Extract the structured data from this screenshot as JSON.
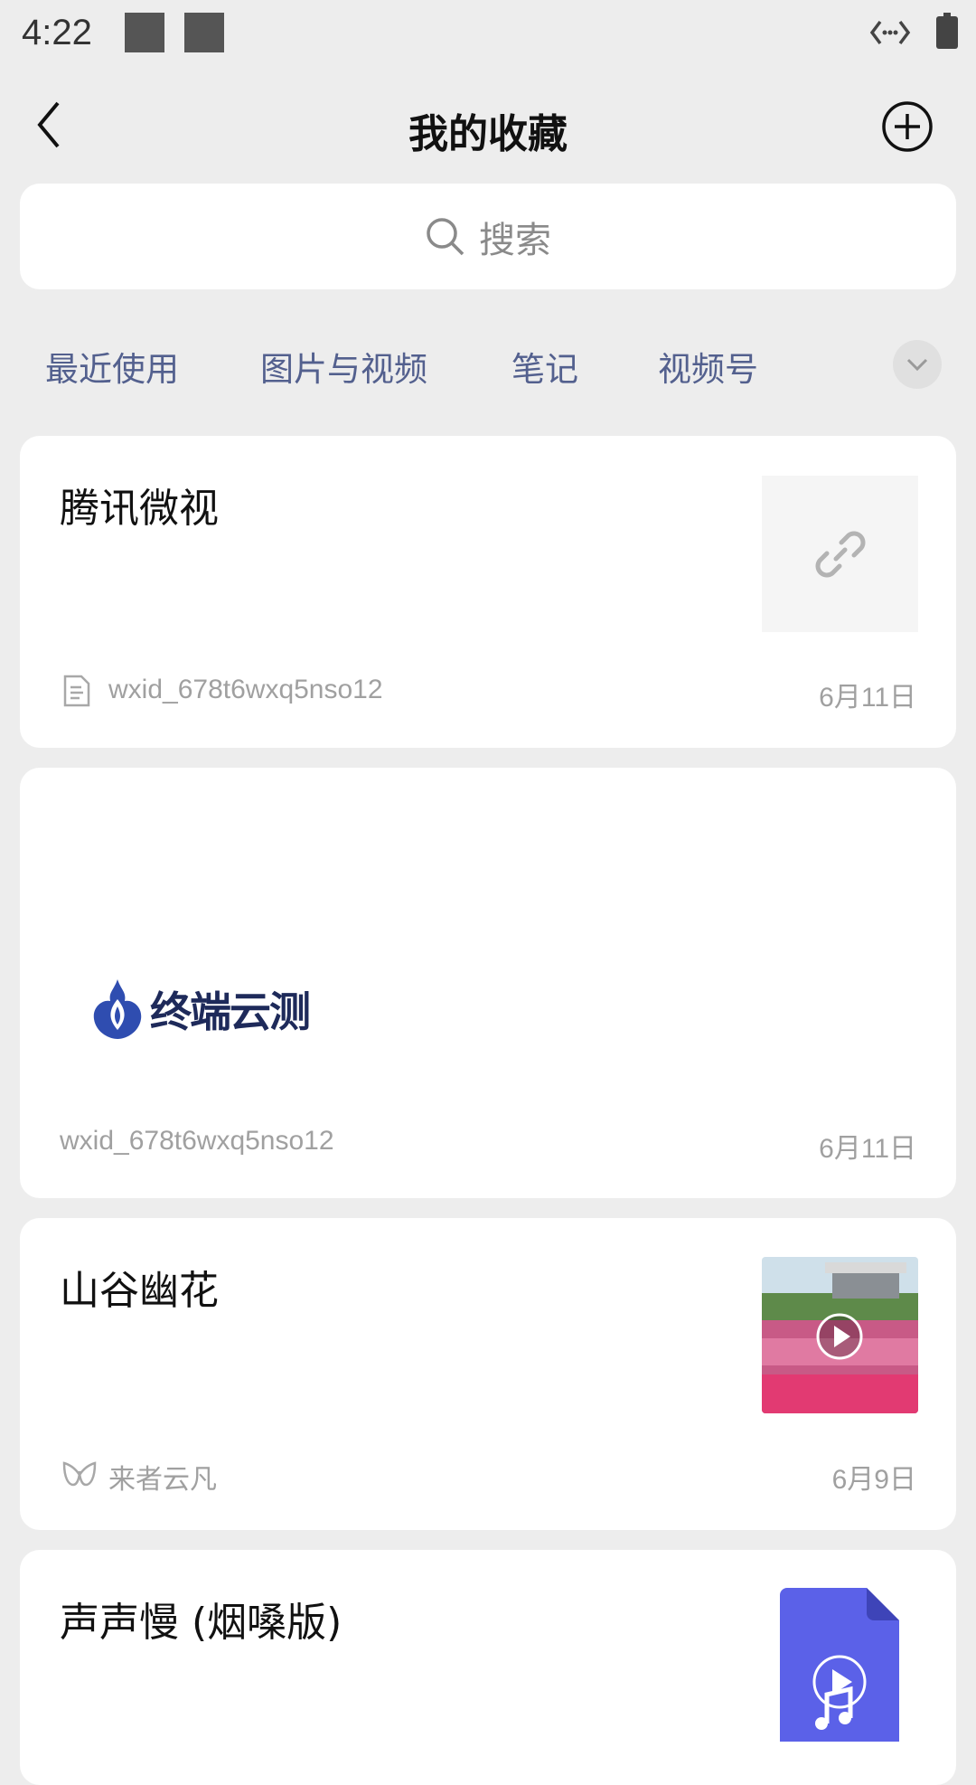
{
  "status_bar": {
    "time": "4:22"
  },
  "header": {
    "title": "我的收藏"
  },
  "search": {
    "placeholder": "搜索"
  },
  "tabs": [
    "最近使用",
    "图片与视频",
    "笔记",
    "视频号"
  ],
  "cards": [
    {
      "title": "腾讯微视",
      "source": "wxid_678t6wxq5nso12",
      "date": "6月11日",
      "type": "link"
    },
    {
      "title": "",
      "source": "wxid_678t6wxq5nso12",
      "date": "6月11日",
      "type": "image",
      "image_text": "终端云测"
    },
    {
      "title": "山谷幽花",
      "source": "来者云凡",
      "date": "6月9日",
      "type": "video"
    },
    {
      "title": "声声慢 (烟嗓版)",
      "type": "music"
    }
  ],
  "colors": {
    "background": "#ededed",
    "tab_text": "#53608e",
    "music_accent": "#5b61e8"
  }
}
